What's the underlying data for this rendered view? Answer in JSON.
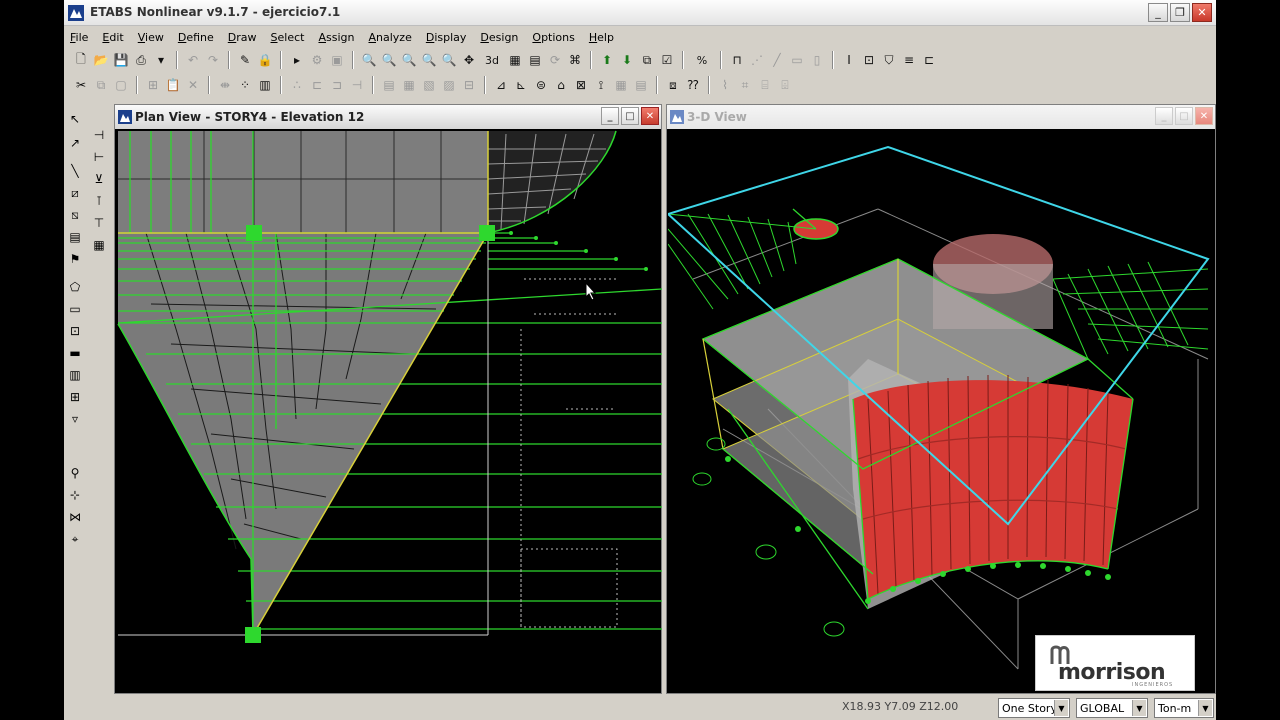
{
  "window": {
    "title": "ETABS Nonlinear v9.1.7 - ejercicio7.1",
    "minimize": "_",
    "restore": "❐",
    "close": "✕"
  },
  "menu": [
    "File",
    "Edit",
    "View",
    "Define",
    "Draw",
    "Select",
    "Assign",
    "Analyze",
    "Display",
    "Design",
    "Options",
    "Help"
  ],
  "toolbar1": {
    "new_icon": "new-file-icon",
    "open_icon": "open-folder-icon",
    "save_icon": "save-icon",
    "view_3d_label": "3d",
    "percent_label": "%"
  },
  "plan_view": {
    "title": "Plan View - STORY4 - Elevation 12"
  },
  "view_3d": {
    "title": "3-D View"
  },
  "status": {
    "coords": "X18.93 Y7.09 Z12.00",
    "story_select": "One Story",
    "coord_system": "GLOBAL",
    "units": "Ton-m"
  },
  "logo": {
    "text": "morrison",
    "subtext": "INGENIEROS"
  },
  "colors": {
    "background": "#d4d0c8",
    "canvas": "#000000",
    "frame_green": "#33dd33",
    "area_gray": "#808080",
    "wall_red": "#d63a35",
    "cyan_outline": "#3fd6e8",
    "yellow_line": "#e4d23a"
  }
}
